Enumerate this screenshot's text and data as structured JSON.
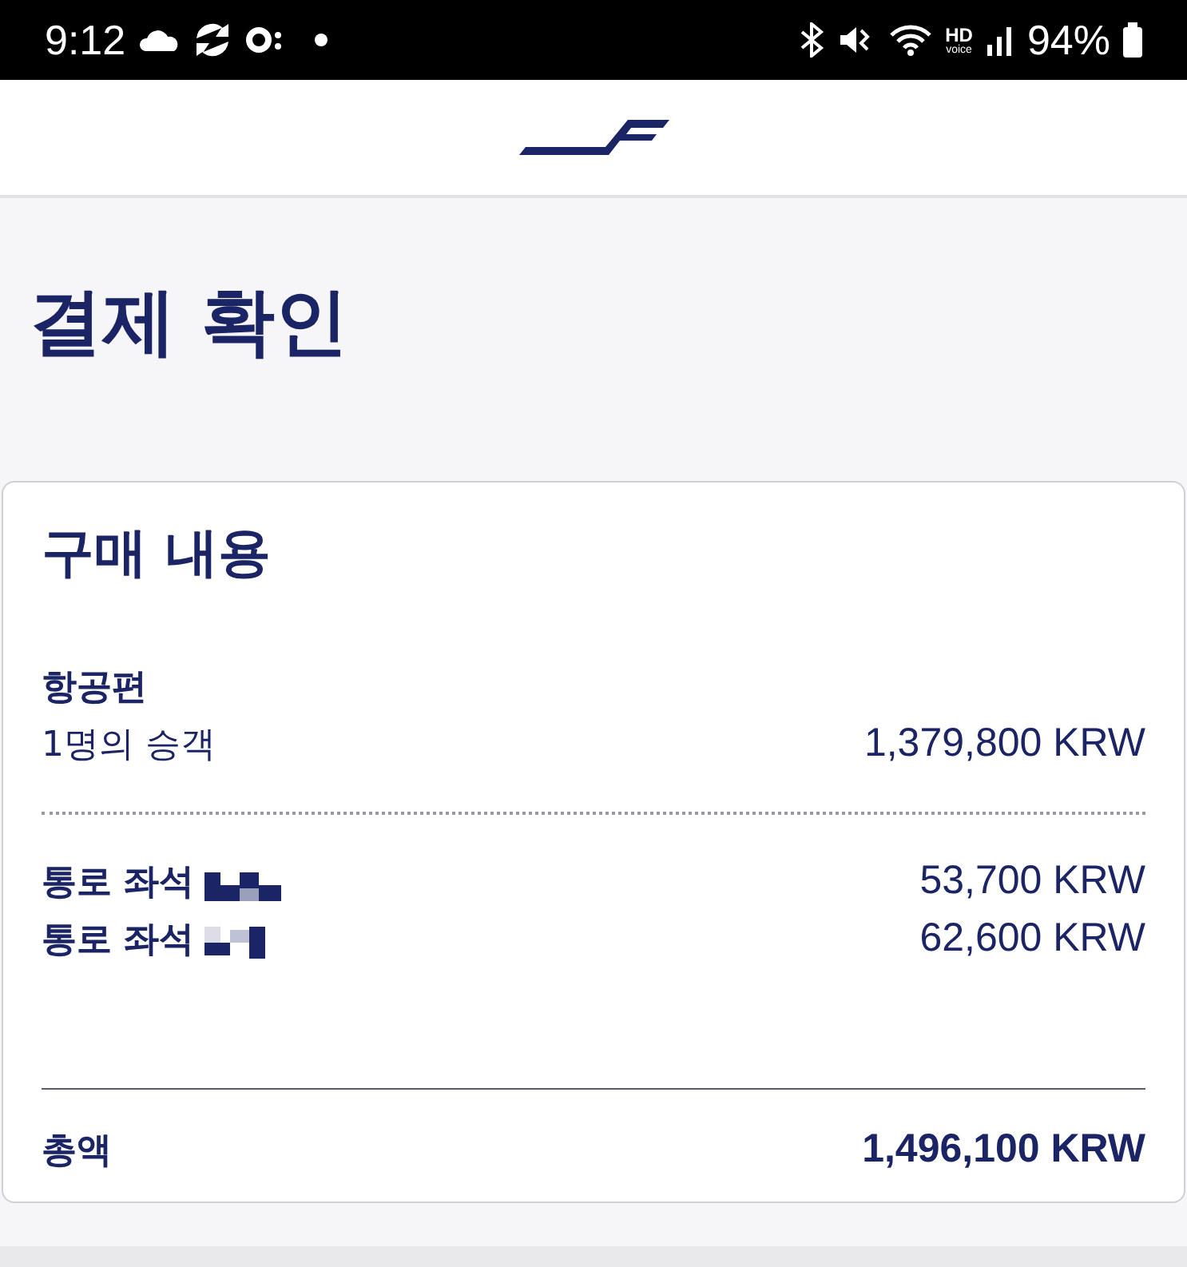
{
  "status_bar": {
    "time": "9:12",
    "hd_label": "HD",
    "hd_sub": "voice",
    "battery": "94%"
  },
  "page": {
    "title": "결제 확인"
  },
  "summary": {
    "heading": "구매 내용",
    "flight": {
      "label": "항공편",
      "passengers": "1명의 승객",
      "price": "1,379,800 KRW"
    },
    "seats": [
      {
        "label": "통로 좌석",
        "price": "53,700 KRW"
      },
      {
        "label": "통로 좌석",
        "price": "62,600 KRW"
      }
    ],
    "total": {
      "label": "총액",
      "price": "1,496,100 KRW"
    }
  }
}
